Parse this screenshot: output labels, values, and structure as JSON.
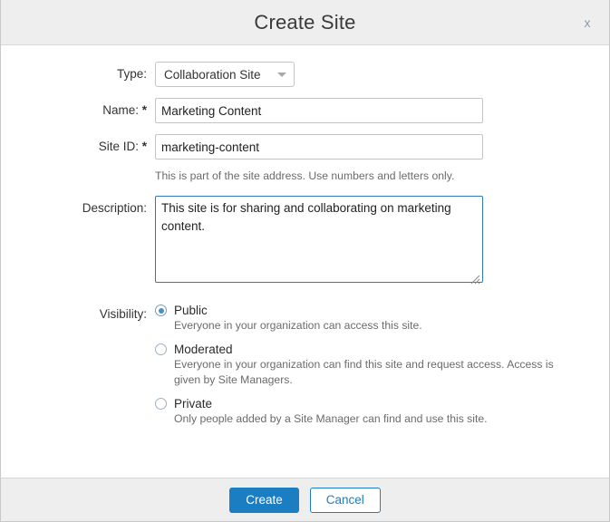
{
  "dialog": {
    "title": "Create Site",
    "close_label": "x"
  },
  "form": {
    "type": {
      "label": "Type:",
      "value": "Collaboration Site",
      "options": [
        "Collaboration Site"
      ]
    },
    "name": {
      "label": "Name:",
      "required_marker": "*",
      "value": "Marketing Content",
      "placeholder": ""
    },
    "site_id": {
      "label": "Site ID:",
      "required_marker": "*",
      "value": "marketing-content",
      "placeholder": "",
      "hint": "This is part of the site address. Use numbers and letters only."
    },
    "description": {
      "label": "Description:",
      "value": "This site is for sharing and collaborating on marketing content.",
      "placeholder": ""
    },
    "visibility": {
      "label": "Visibility:",
      "selected": "Public",
      "options": [
        {
          "label": "Public",
          "description": "Everyone in your organization can access this site.",
          "selected": true
        },
        {
          "label": "Moderated",
          "description": "Everyone in your organization can find this site and request access. Access is given by Site Managers.",
          "selected": false
        },
        {
          "label": "Private",
          "description": "Only people added by a Site Manager can find and use this site.",
          "selected": false
        }
      ]
    }
  },
  "footer": {
    "create_label": "Create",
    "cancel_label": "Cancel"
  },
  "colors": {
    "primary": "#1b7ec2",
    "focus_border": "#2e7ab8",
    "header_bg": "#eeeeee",
    "radio_dot": "#4a90c4"
  }
}
